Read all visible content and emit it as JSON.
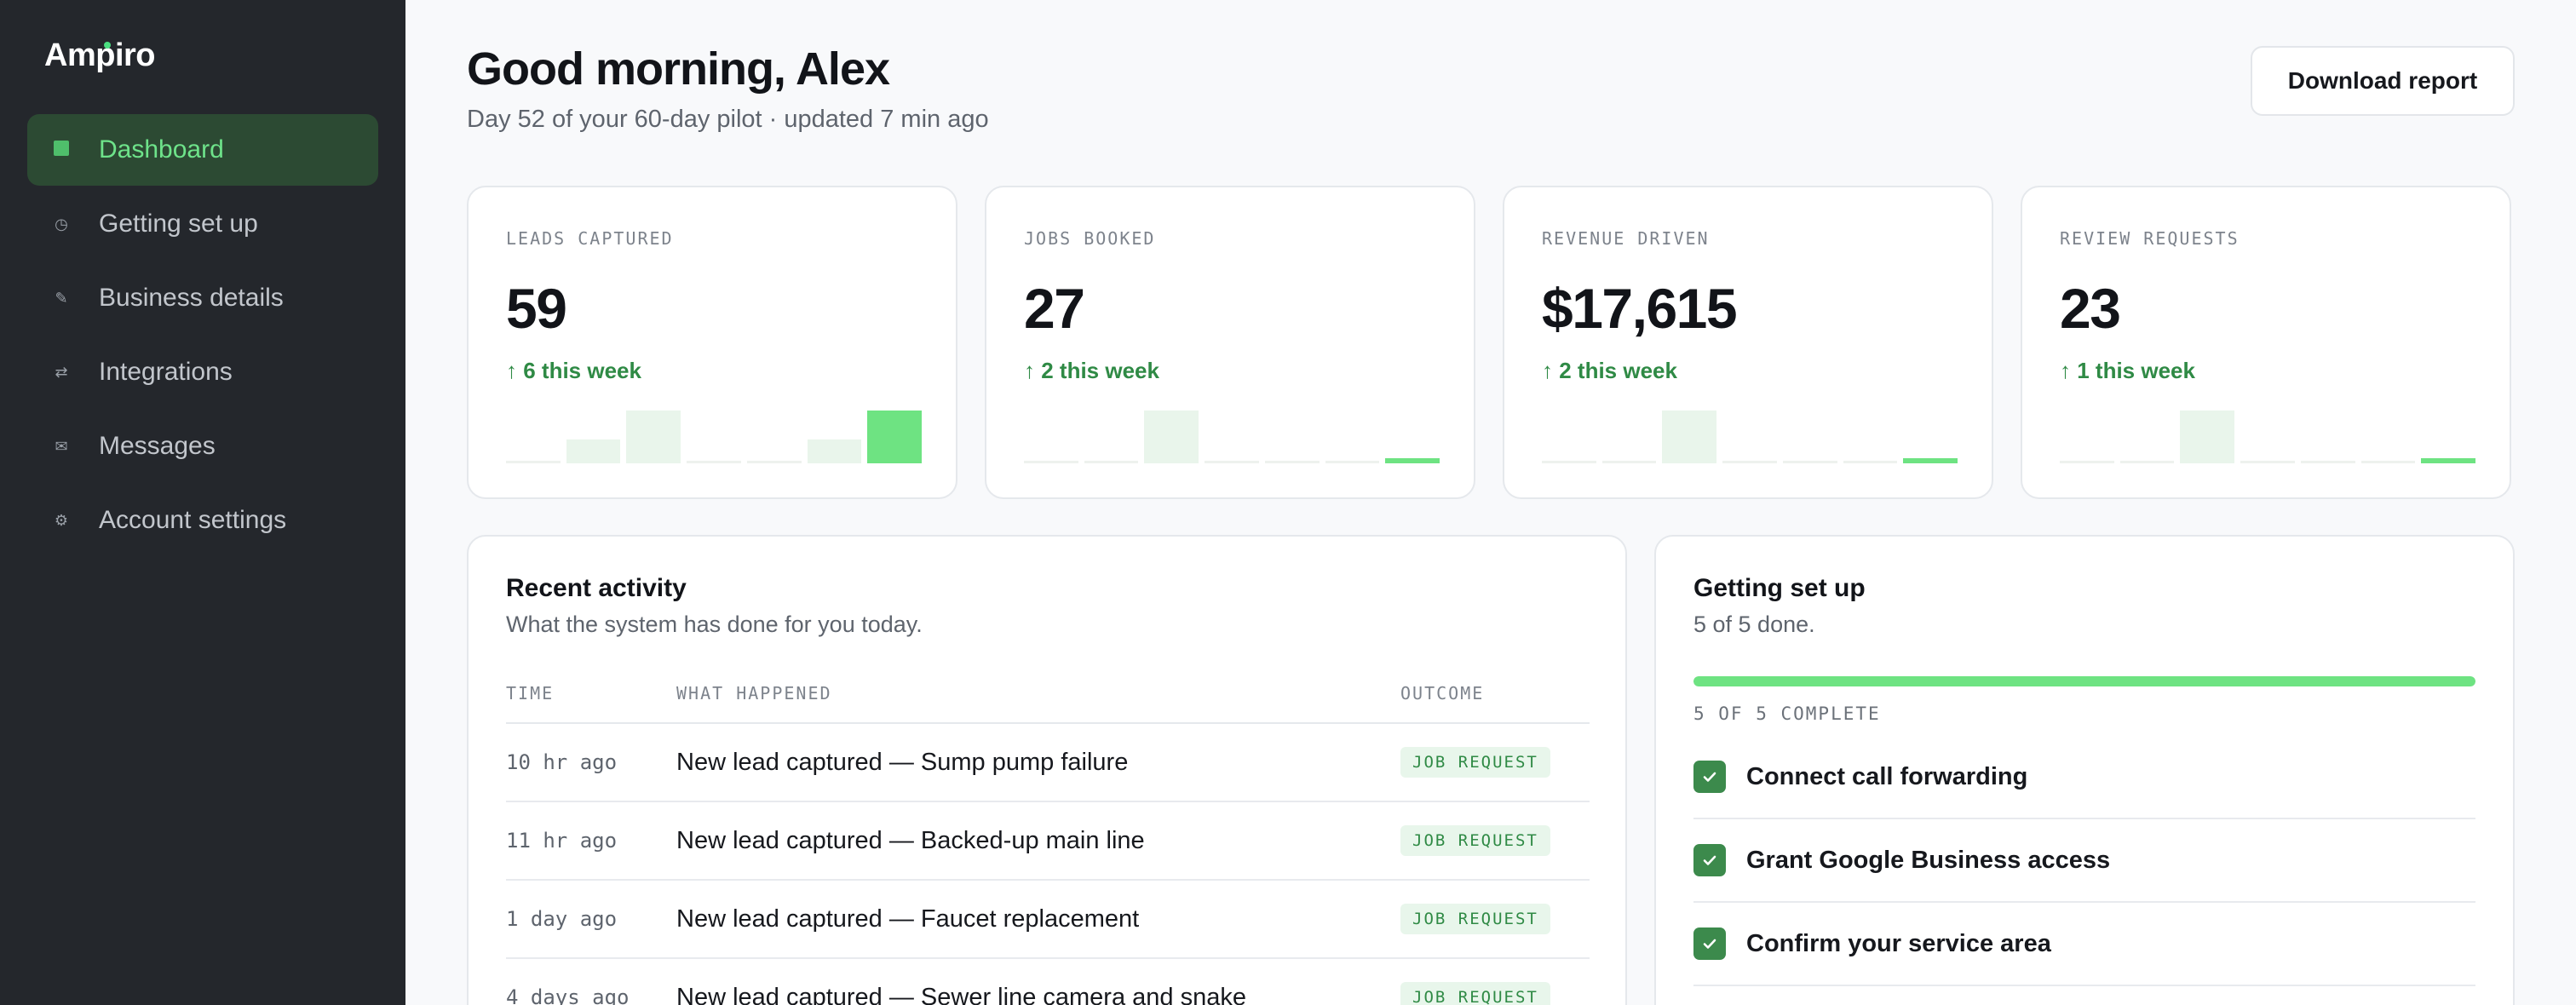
{
  "brand": "Ampiro",
  "colors": {
    "accent": "#4ade80",
    "sidebar_bg": "#24272c",
    "success_text": "#2f8a45"
  },
  "sidebar": {
    "items": [
      {
        "label": "Dashboard",
        "icon": "dashboard-square-icon",
        "glyph": "",
        "active": true
      },
      {
        "label": "Getting set up",
        "icon": "clock-icon",
        "glyph": "◷",
        "active": false
      },
      {
        "label": "Business details",
        "icon": "pencil-icon",
        "glyph": "✎",
        "active": false
      },
      {
        "label": "Integrations",
        "icon": "swap-arrows-icon",
        "glyph": "⇄",
        "active": false
      },
      {
        "label": "Messages",
        "icon": "envelope-icon",
        "glyph": "✉",
        "active": false
      },
      {
        "label": "Account settings",
        "icon": "gear-icon",
        "glyph": "⚙",
        "active": false
      }
    ]
  },
  "header": {
    "greeting": "Good morning, Alex",
    "subtitle": "Day 52 of your 60-day pilot · updated 7 min ago",
    "download_label": "Download report"
  },
  "stats": [
    {
      "label": "LEADS CAPTURED",
      "value": "59",
      "delta": "↑ 6 this week",
      "spark": [
        0,
        0.45,
        1.0,
        0,
        0,
        0.45,
        1.0
      ]
    },
    {
      "label": "JOBS BOOKED",
      "value": "27",
      "delta": "↑ 2 this week",
      "spark": [
        0,
        0,
        1.0,
        0,
        0,
        0,
        0.1
      ]
    },
    {
      "label": "REVENUE DRIVEN",
      "value": "$17,615",
      "delta": "↑ 2 this week",
      "spark": [
        0,
        0,
        1.0,
        0,
        0,
        0,
        0.1
      ]
    },
    {
      "label": "REVIEW REQUESTS",
      "value": "23",
      "delta": "↑ 1 this week",
      "spark": [
        0,
        0,
        1.0,
        0,
        0,
        0,
        0.1
      ]
    }
  ],
  "activity": {
    "title": "Recent activity",
    "subtitle": "What the system has done for you today.",
    "columns": {
      "time": "TIME",
      "what": "WHAT HAPPENED",
      "outcome": "OUTCOME"
    },
    "rows": [
      {
        "time": "10 hr ago",
        "what": "New lead captured — Sump pump failure",
        "outcome": "JOB REQUEST"
      },
      {
        "time": "11 hr ago",
        "what": "New lead captured — Backed-up main line",
        "outcome": "JOB REQUEST"
      },
      {
        "time": "1 day ago",
        "what": "New lead captured — Faucet replacement",
        "outcome": "JOB REQUEST"
      },
      {
        "time": "4 days ago",
        "what": "New lead captured — Sewer line camera and snake",
        "outcome": "JOB REQUEST"
      }
    ]
  },
  "setup": {
    "title": "Getting set up",
    "subtitle": "5 of 5 done.",
    "progress_fraction": 1.0,
    "progress_label": "5 OF 5 COMPLETE",
    "items": [
      {
        "label": "Connect call forwarding",
        "done": true
      },
      {
        "label": "Grant Google Business access",
        "done": true
      },
      {
        "label": "Confirm your service area",
        "done": true
      }
    ]
  }
}
